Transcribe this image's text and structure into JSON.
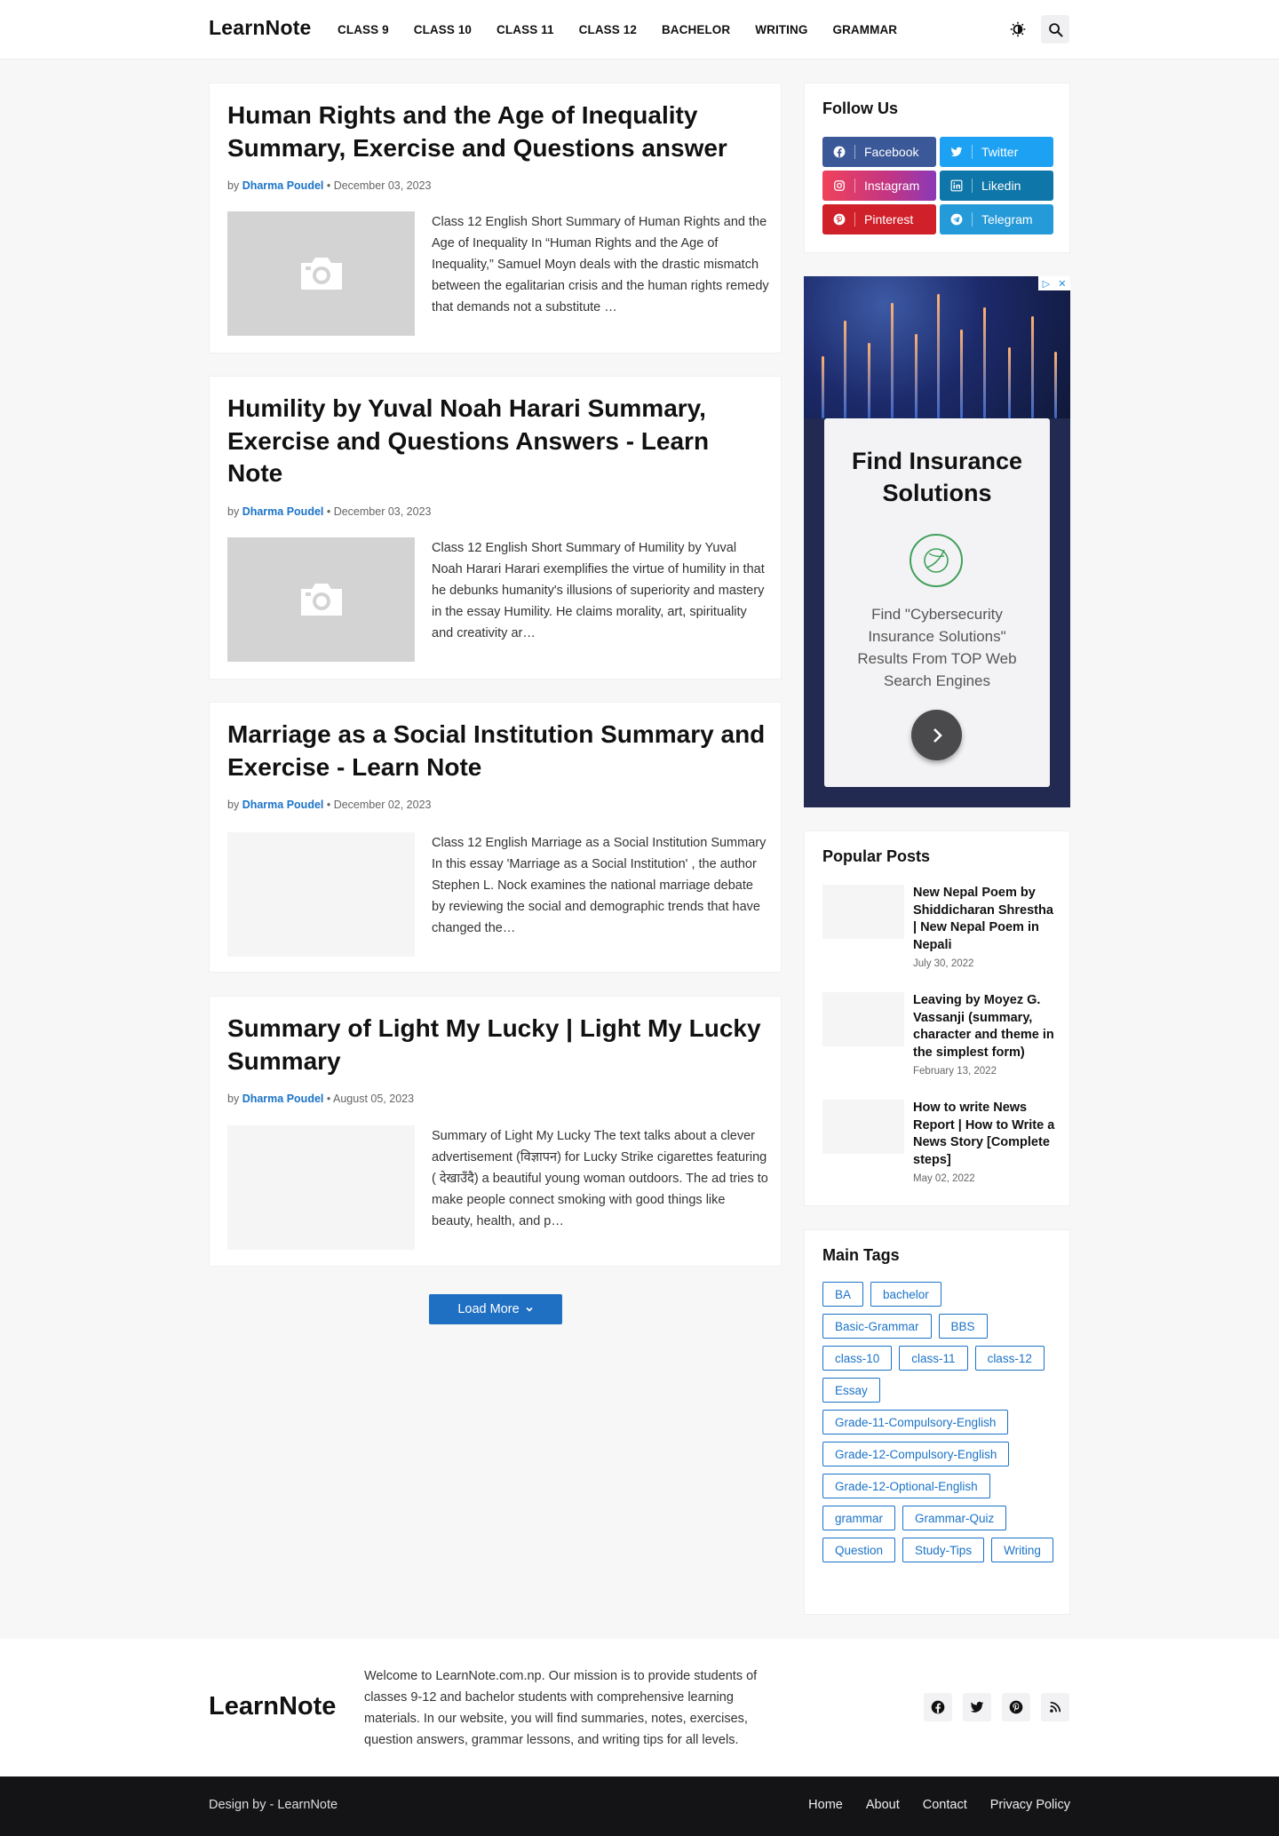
{
  "site": {
    "logo": "LearnNote"
  },
  "nav": [
    "CLASS 9",
    "CLASS 10",
    "CLASS 11",
    "CLASS 12",
    "BACHELOR",
    "WRITING",
    "GRAMMAR"
  ],
  "header_icons": [
    "theme-toggle-icon",
    "search-icon"
  ],
  "posts": [
    {
      "title": "Human Rights and the Age of Inequality Summary, Exercise and Questions answer",
      "by": "by",
      "author": "Dharma Poudel",
      "date": "December 03, 2023",
      "excerpt": "Class 12 English Short Summary of Human Rights and the Age of Inequality In “Human Rights and the Age of Inequality,” Samuel Moyn deals with the drastic mismatch between the egalitarian crisis and the human rights remedy that demands not a substitute …"
    },
    {
      "title": "Humility by Yuval Noah Harari Summary, Exercise and Questions Answers - Learn Note",
      "by": "by",
      "author": "Dharma Poudel",
      "date": "December 03, 2023",
      "excerpt": "Class 12 English Short Summary of Humility by Yuval Noah Harari Harari exemplifies the virtue of humility in that he debunks humanity's illusions of superiority and mastery in the essay Humility. He claims morality, art, spirituality and creativity ar…"
    },
    {
      "title": "Marriage as a Social Institution Summary and Exercise - Learn Note",
      "by": "by",
      "author": "Dharma Poudel",
      "date": "December 02, 2023",
      "excerpt": "Class 12 English Marriage as a Social Institution Summary In this essay 'Marriage as a Social Institution' , the author Stephen L. Nock examines the national marriage debate by reviewing the social and demographic trends that have changed the…"
    },
    {
      "title": "Summary of Light My Lucky | Light My Lucky Summary",
      "by": "by",
      "author": "Dharma Poudel",
      "date": "August 05, 2023",
      "excerpt": "Summary of Light My Lucky The text talks about a clever advertisement (विज्ञापन) for Lucky Strike cigarettes featuring ( देखाउँदै) a beautiful young woman outdoors. The ad tries to make people connect smoking with good things like beauty, health, and p…"
    }
  ],
  "load_more": "Load More",
  "follow": {
    "title": "Follow Us",
    "items": [
      {
        "label": "Facebook",
        "color": "#3b5998",
        "icon": "facebook-icon"
      },
      {
        "label": "Twitter",
        "color": "#1da1f2",
        "icon": "twitter-icon"
      },
      {
        "label": "Instagram",
        "color": "#c13584",
        "icon": "instagram-icon"
      },
      {
        "label": "Likedin",
        "color": "#0e76a8",
        "icon": "linkedin-icon"
      },
      {
        "label": "Pinterest",
        "color": "#d0202a",
        "icon": "pinterest-icon"
      },
      {
        "label": "Telegram",
        "color": "#259ad8",
        "icon": "telegram-icon"
      }
    ]
  },
  "ad": {
    "title": "Find Insurance Solutions",
    "text": "Find \"Cybersecurity Insurance Solutions\" Results From TOP Web Search Engines"
  },
  "popular": {
    "title": "Popular Posts",
    "items": [
      {
        "title": "New Nepal Poem by Shiddicharan Shrestha | New Nepal Poem in Nepali",
        "date": "July 30, 2022"
      },
      {
        "title": "Leaving by Moyez G. Vassanji (summary, character and theme in the simplest form)",
        "date": "February 13, 2022"
      },
      {
        "title": "How to write News Report | How to Write a News Story [Complete steps]",
        "date": "May 02, 2022"
      }
    ]
  },
  "tags": {
    "title": "Main Tags",
    "items": [
      "BA",
      "bachelor",
      "Basic-Grammar",
      "BBS",
      "class-10",
      "class-11",
      "class-12",
      "Essay",
      "Grade-11-Compulsory-English",
      "Grade-12-Compulsory-English",
      "Grade-12-Optional-English",
      "grammar",
      "Grammar-Quiz",
      "Question",
      "Study-Tips",
      "Writing"
    ]
  },
  "footer": {
    "logo": "LearnNote",
    "about": "Welcome to LearnNote.com.np. Our mission is to provide students of classes 9-12 and bachelor students with comprehensive learning materials. In our website, you will find summaries, notes, exercises, question answers, grammar lessons, and writing tips for all levels.",
    "social_icons": [
      "facebook-icon",
      "twitter-icon",
      "pinterest-icon",
      "rss-icon"
    ],
    "credit": "Design by - LearnNote",
    "links": [
      "Home",
      "About",
      "Contact",
      "Privacy Policy"
    ]
  }
}
